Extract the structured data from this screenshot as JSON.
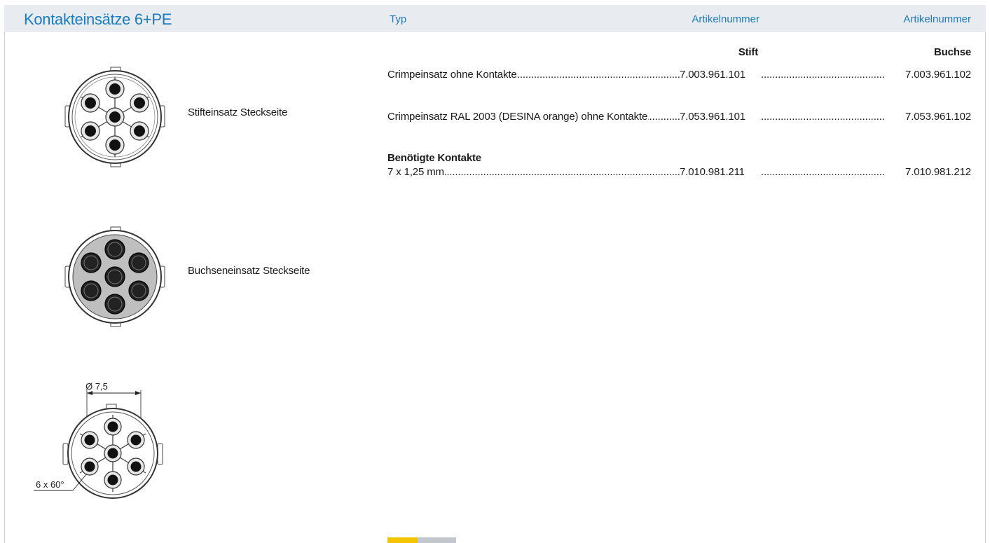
{
  "header": {
    "title": "Kontakteinsätze 6+PE",
    "col_typ": "Typ",
    "col_article_1": "Artikelnummer",
    "col_article_2": "Artikelnummer"
  },
  "subheaders": {
    "stift": "Stift",
    "buchse": "Buchse"
  },
  "items": [
    {
      "label": "Crimpeinsatz ohne Kontakte",
      "stift": "7.003.961.101",
      "buchse": "7.003.961.102"
    },
    {
      "label": "Crimpeinsatz RAL 2003 (DESINA orange) ohne Kontakte",
      "stift": "7.053.961.101",
      "buchse": "7.053.961.102"
    }
  ],
  "contacts": {
    "heading": "Benötigte Kontakte",
    "items": [
      {
        "label": "7 x 1,25 mm",
        "stift": "7.010.981.211",
        "buchse": "7.010.981.212"
      }
    ]
  },
  "views": [
    {
      "label": "Stifteinsatz Steckseite"
    },
    {
      "label": "Buchseneinsatz Steckseite"
    }
  ],
  "dimensions": {
    "diameter": "Ø 7,5",
    "angle": "6 x 60°"
  },
  "colors": {
    "accent": "#1a7bbf",
    "header_bg": "#e8ebf0",
    "tab_yellow": "#f4c400",
    "tab_grey": "#c3c6cc"
  }
}
